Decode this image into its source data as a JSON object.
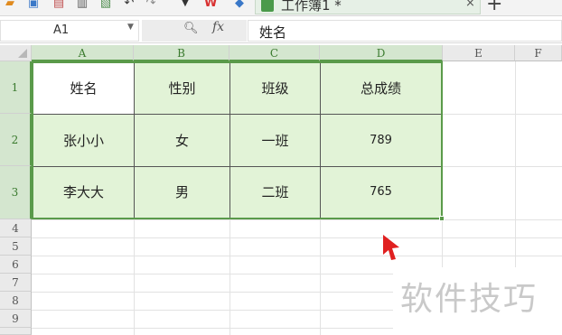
{
  "toolbar": {
    "document_tab_title": "工作簿1 *",
    "close_tab_glyph": "×",
    "add_tab_glyph": "+"
  },
  "formula_bar": {
    "name_box": "A1",
    "fx_label": "fx",
    "formula_value": "姓名"
  },
  "columns": [
    "A",
    "B",
    "C",
    "D",
    "E",
    "F"
  ],
  "rows": [
    "1",
    "2",
    "3",
    "4",
    "5",
    "6",
    "7",
    "8",
    "9"
  ],
  "table": {
    "header": [
      "姓名",
      "性别",
      "班级",
      "总成绩"
    ],
    "rows": [
      [
        "张小小",
        "女",
        "一班",
        "789"
      ],
      [
        "李大大",
        "男",
        "二班",
        "765"
      ]
    ]
  },
  "watermark": "软件技巧",
  "colors": {
    "selection_green": "#5a9a4a",
    "cell_fill": "#e2f3d7",
    "cursor_red": "#e02020"
  }
}
